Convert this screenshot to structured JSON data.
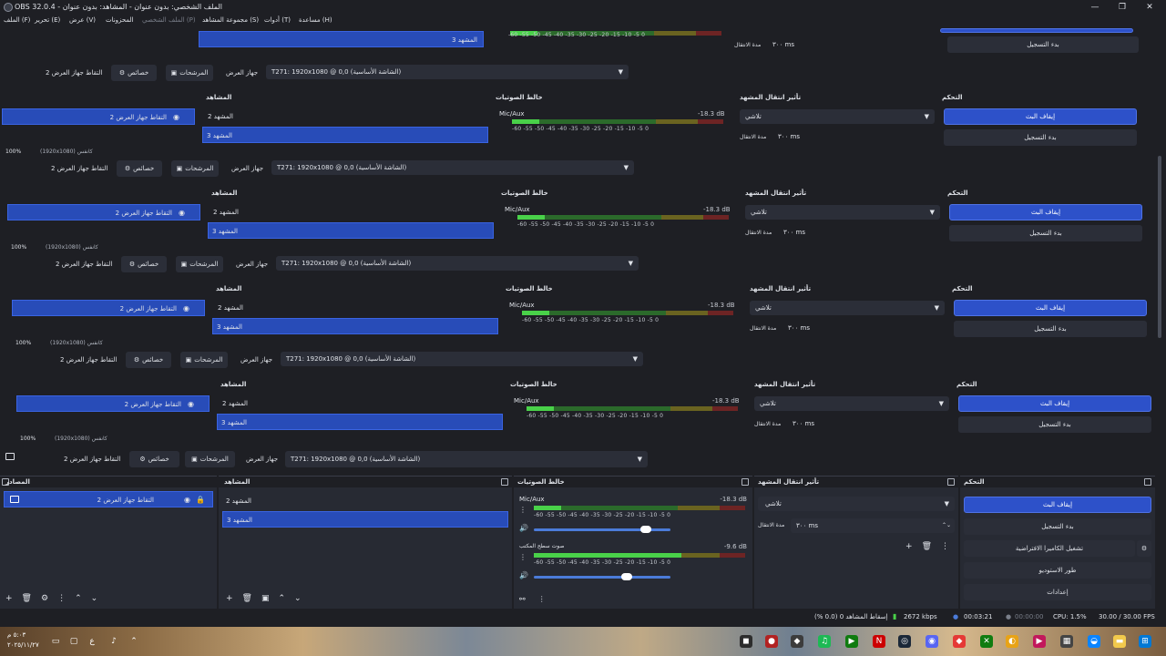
{
  "window": {
    "title": "OBS 32.0.4 - الملف الشخصي: بدون عنوان - المشاهد: بدون عنوان",
    "controls": [
      "—",
      "❐",
      "✕"
    ]
  },
  "menu": {
    "items": [
      "الملف (F)",
      "تحرير (E)",
      "عرض (V)",
      "المحزونات",
      "الملف الشخصي (P)",
      "مجموعة المشاهد (S)",
      "أدوات (T)",
      "مساعدة (H)"
    ]
  },
  "toolbar": {
    "capture_label": "التقاط جهاز العرض 2",
    "properties": "خصائص",
    "filters": "المرشحات",
    "device_label": "جهاز العرض",
    "device_value": "T271: 1920x1080 @ 0,0 (الشاشة الأساسية)",
    "zoom": "100%",
    "zoom_mode": "(1920x1080) كانفس"
  },
  "docks": {
    "sources": "المصادر",
    "scenes": "المشاهد",
    "mixer": "خالط الصوتيات",
    "transitions": "تأثير انتقال المشهد",
    "controls": "التحكم"
  },
  "sources": [
    {
      "name": "التقاط جهاز العرض 2"
    }
  ],
  "scenes": [
    "المشهد 2",
    "المشهد 3"
  ],
  "mixer": {
    "channels": [
      {
        "name": "Mic/Aux",
        "db": "-18.3 dB",
        "level": 0.13,
        "volume": 0.82
      },
      {
        "name": "صوت سطح المكتب",
        "db": "-9.6 dB",
        "level": 0.7,
        "volume": 0.68
      }
    ],
    "ticks": "-60 -55 -50 -45 -40 -35 -30 -25 -20 -15 -10 -5 0"
  },
  "transitions": {
    "type": "تلاشي",
    "duration_label": "مدة الانتقال",
    "duration_value": "٣٠٠ ms"
  },
  "controls": {
    "stop_stream": "إيقاف البث",
    "start_record": "بدء التسجيل",
    "virtual_camera": "تشغيل الكاميرا الافتراضية",
    "studio_mode": "طور الاستوديو",
    "settings": "إعدادات"
  },
  "status": {
    "dropped": "إسقاط المشاهد 0 (0.0 %)",
    "bitrate": "2672 kbps",
    "stream_time": "00:03:21",
    "rec_time": "00:00:00",
    "cpu": "CPU: 1.5%",
    "fps": "30.00 / 30.00 FPS"
  },
  "taskbar": {
    "time": "٥:٠٣ م",
    "date": "٢٠٢٥/١١/٢٧",
    "lang": "ع"
  },
  "colors": {
    "accent": "#2d51c9",
    "panel": "#272a33",
    "background": "#1e1f24"
  }
}
